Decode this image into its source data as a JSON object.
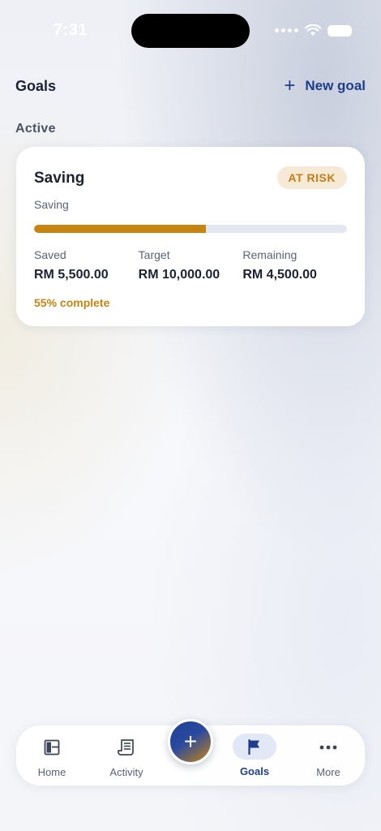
{
  "status_bar": {
    "time": "7:31"
  },
  "header": {
    "title": "Goals",
    "new_goal_label": "New goal",
    "new_goal_icon": "plus-icon"
  },
  "section": {
    "label": "Active"
  },
  "goal_card": {
    "name": "Saving",
    "badge": "AT RISK",
    "type": "Saving",
    "progress_fraction": 0.55,
    "stats": [
      {
        "label": "Saved",
        "value": "RM 5,500.00"
      },
      {
        "label": "Target",
        "value": "RM 10,000.00"
      },
      {
        "label": "Remaining",
        "value": "RM 4,500.00"
      }
    ],
    "complete_text": "55% complete"
  },
  "tab_bar": {
    "tabs": [
      {
        "label": "Home",
        "icon": "layout-icon"
      },
      {
        "label": "Activity",
        "icon": "receipt-icon"
      },
      {
        "label": "Goals",
        "icon": "flag-icon",
        "active": true
      },
      {
        "label": "More",
        "icon": "more-icon"
      }
    ],
    "fab_icon": "plus-icon"
  },
  "colors": {
    "accent": "#1e3d8a",
    "warning": "#c88410",
    "badge_bg": "#f6ead6"
  }
}
